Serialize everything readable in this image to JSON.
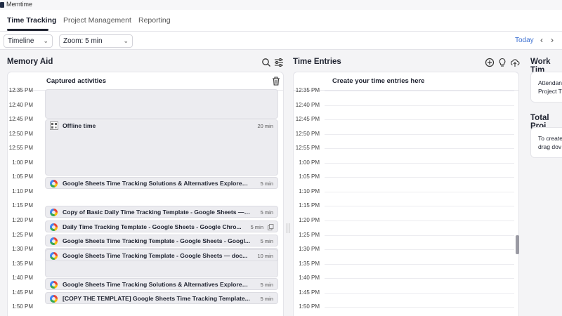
{
  "app": {
    "title": "Memtime"
  },
  "nav": {
    "items": [
      "Time Tracking",
      "Project Management",
      "Reporting"
    ]
  },
  "toolbar": {
    "view": "Timeline",
    "zoom": "Zoom: 5 min",
    "today": "Today"
  },
  "memory_aid": {
    "title": "Memory Aid",
    "subheader": "Captured activities",
    "offline": {
      "label": "Offline time",
      "duration": "20 min"
    },
    "activities": [
      {
        "title": "Google Sheets Time Tracking Solutions & Alternatives Explored ...",
        "duration": "5 min"
      },
      {
        "title": "Copy of Basic Daily Time Tracking Template - Google Sheets — ...",
        "duration": "5 min"
      },
      {
        "title": "Daily Time Tracking Template - Google Sheets - Google Chro...",
        "duration": "5 min"
      },
      {
        "title": "Google Sheets Time Tracking Template - Google Sheets - Googl...",
        "duration": "5 min"
      },
      {
        "title": "Google Sheets Time Tracking Template - Google Sheets — doc...",
        "duration": "10 min"
      },
      {
        "title": "Google Sheets Time Tracking Solutions & Alternatives Explored ...",
        "duration": "5 min"
      },
      {
        "title": "[COPY THE TEMPLATE] Google Sheets Time Tracking Template...",
        "duration": "5 min"
      }
    ]
  },
  "time_entries": {
    "title": "Time Entries",
    "subheader": "Create your time entries here"
  },
  "times": [
    "12:35 PM",
    "12:40 PM",
    "12:45 PM",
    "12:50 PM",
    "12:55 PM",
    "1:00 PM",
    "1:05 PM",
    "1:10 PM",
    "1:15 PM",
    "1:20 PM",
    "1:25 PM",
    "1:30 PM",
    "1:35 PM",
    "1:40 PM",
    "1:45 PM",
    "1:50 PM"
  ],
  "work_time": {
    "title": "Work Tim",
    "line1": "Attendan",
    "line2": "Project T"
  },
  "total_projects": {
    "title": "Total Proj",
    "line1": "To create",
    "line2": "drag dov"
  }
}
